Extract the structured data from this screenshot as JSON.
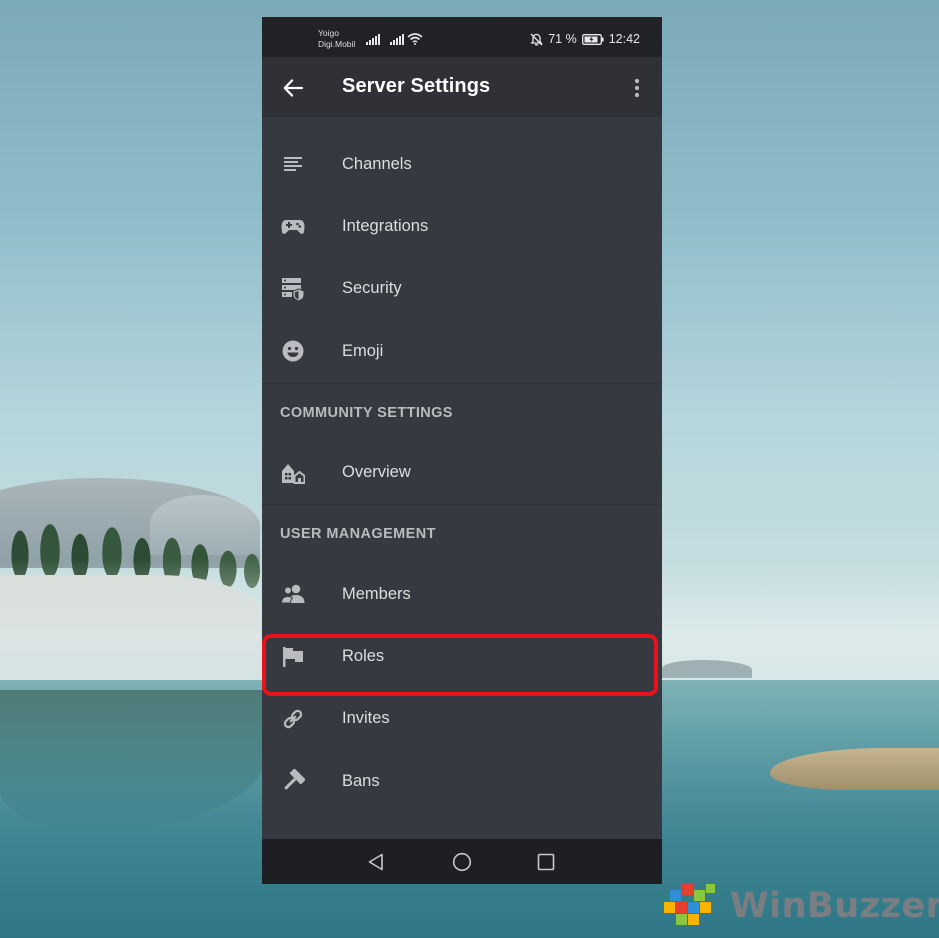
{
  "status_bar": {
    "carrier_line1": "Yoigo",
    "carrier_line2": "Digi.Mobil",
    "battery_percent": "71 %",
    "time": "12:42"
  },
  "app_bar": {
    "title": "Server Settings"
  },
  "menu": {
    "items": [
      {
        "label": "Channels",
        "icon": "list-icon"
      },
      {
        "label": "Integrations",
        "icon": "gamepad-icon"
      },
      {
        "label": "Security",
        "icon": "server-shield-icon"
      },
      {
        "label": "Emoji",
        "icon": "smiley-icon"
      }
    ],
    "community_section": {
      "header": "COMMUNITY SETTINGS",
      "items": [
        {
          "label": "Overview",
          "icon": "community-house-icon"
        }
      ]
    },
    "user_management_section": {
      "header": "USER MANAGEMENT",
      "items": [
        {
          "label": "Members",
          "icon": "people-icon"
        },
        {
          "label": "Roles",
          "icon": "flag-icon",
          "highlighted": true
        },
        {
          "label": "Invites",
          "icon": "link-icon"
        },
        {
          "label": "Bans",
          "icon": "hammer-icon"
        }
      ]
    }
  },
  "highlight_color": "#e8121b",
  "theme": {
    "background": "#36393f",
    "app_bar": "#2f3136",
    "status_bar": "#202225",
    "text": "#dcddde",
    "section_text": "#b9bbbe"
  },
  "watermark": {
    "text": "WinBuzzer"
  }
}
